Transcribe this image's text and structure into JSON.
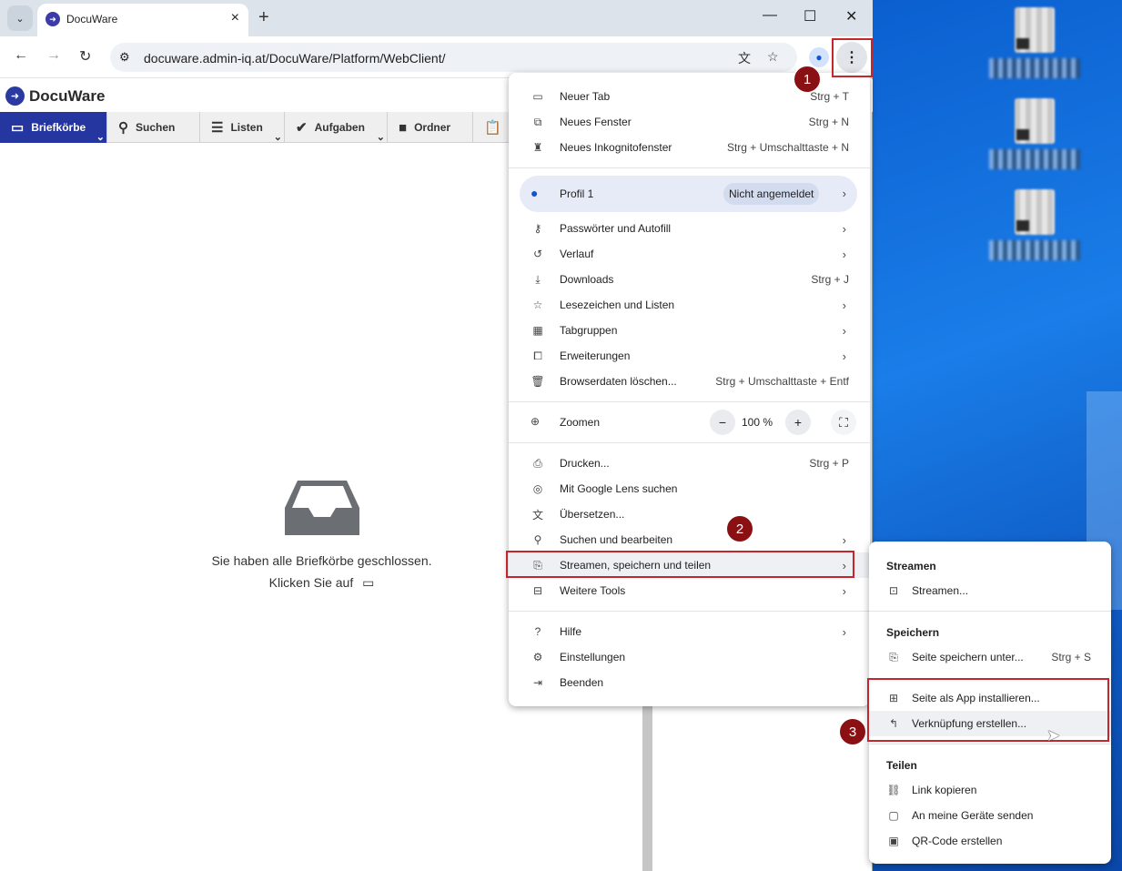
{
  "browser": {
    "tab_title": "DocuWare",
    "url": "docuware.admin-iq.at/DocuWare/Platform/WebClient/"
  },
  "app": {
    "logo": "DocuWare",
    "tabs": [
      {
        "label": "Briefkörbe",
        "icon": "inbox-icon"
      },
      {
        "label": "Suchen",
        "icon": "search-icon"
      },
      {
        "label": "Listen",
        "icon": "list-icon"
      },
      {
        "label": "Aufgaben",
        "icon": "check-icon"
      },
      {
        "label": "Ordner",
        "icon": "folder-icon"
      }
    ],
    "empty_message": "Sie haben alle Briefkörbe geschlossen.",
    "empty_hint": "Klicken Sie auf"
  },
  "menu": {
    "new_tab": {
      "label": "Neuer Tab",
      "shortcut": "Strg + T"
    },
    "new_window": {
      "label": "Neues Fenster",
      "shortcut": "Strg + N"
    },
    "incognito": {
      "label": "Neues Inkognitofenster",
      "shortcut": "Strg + Umschalttaste + N"
    },
    "profile": {
      "label": "Profil 1",
      "badge": "Nicht angemeldet"
    },
    "passwords": "Passwörter und Autofill",
    "history": "Verlauf",
    "downloads": {
      "label": "Downloads",
      "shortcut": "Strg + J"
    },
    "bookmarks": "Lesezeichen und Listen",
    "tabgroups": "Tabgruppen",
    "extensions": "Erweiterungen",
    "clear_data": {
      "label": "Browserdaten löschen...",
      "shortcut": "Strg + Umschalttaste + Entf"
    },
    "zoom": {
      "label": "Zoomen",
      "value": "100 %"
    },
    "print": {
      "label": "Drucken...",
      "shortcut": "Strg + P"
    },
    "lens": "Mit Google Lens suchen",
    "translate": "Übersetzen...",
    "find_edit": "Suchen und bearbeiten",
    "cast_save_share": "Streamen, speichern und teilen",
    "more_tools": "Weitere Tools",
    "help": "Hilfe",
    "settings": "Einstellungen",
    "exit": "Beenden"
  },
  "submenu": {
    "stream_header": "Streamen",
    "stream": "Streamen...",
    "save_header": "Speichern",
    "save_page": {
      "label": "Seite speichern unter...",
      "shortcut": "Strg + S"
    },
    "install_app": "Seite als App installieren...",
    "create_shortcut": "Verknüpfung erstellen...",
    "share_header": "Teilen",
    "copy_link": "Link kopieren",
    "send_devices": "An meine Geräte senden",
    "qr_code": "QR-Code erstellen"
  },
  "annotations": [
    "1",
    "2",
    "3"
  ],
  "colors": {
    "annotation": "#c4262e",
    "badge": "#8b1014",
    "docuware_brand": "#2636a0"
  }
}
